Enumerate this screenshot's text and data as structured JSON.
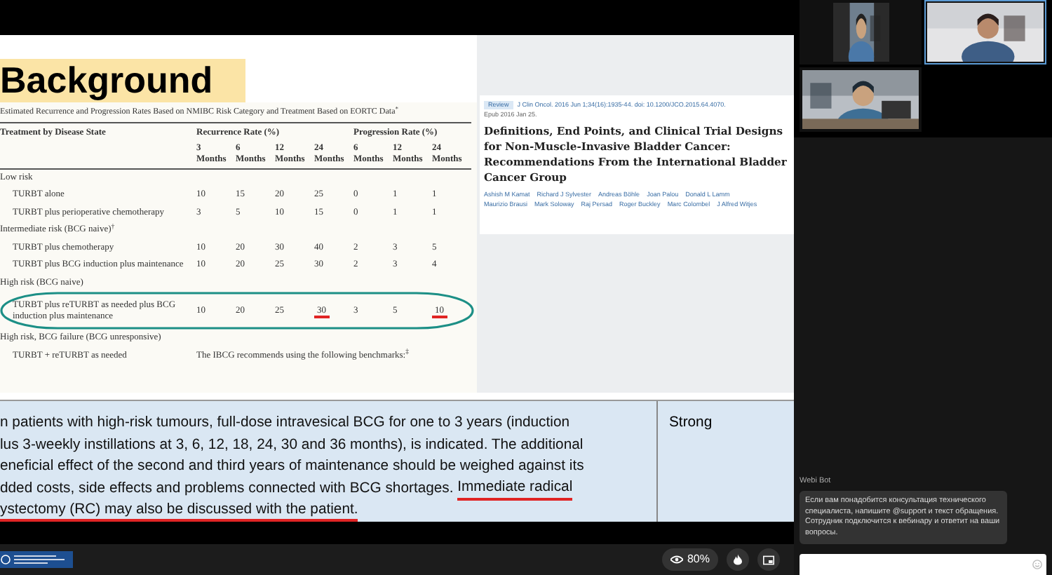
{
  "slide": {
    "title": "Background",
    "table": {
      "caption": "Estimated Recurrence and Progression Rates Based on NMIBC Risk Category and Treatment Based on EORTC Data$^{*}$",
      "columns": [
        "Treatment by Disease State",
        "Recurrence Rate (%)",
        "Progression Rate (%)"
      ],
      "subcolumns": [
        {
          "number": "3",
          "unit": "Months"
        },
        {
          "number": "6",
          "unit": "Months"
        },
        {
          "number": "12",
          "unit": "Months"
        },
        {
          "number": "24",
          "unit": "Months"
        },
        {
          "number": "6",
          "unit": "Months"
        },
        {
          "number": "12",
          "unit": "Months"
        },
        {
          "number": "24",
          "unit": "Months"
        }
      ],
      "rows": [
        {
          "kind": "group",
          "label": "Low risk"
        },
        {
          "kind": "item",
          "label": "TURBT alone",
          "circled": false,
          "values": [
            {
              "text": "10",
              "underlined": false
            },
            {
              "text": "15",
              "underlined": false
            },
            {
              "text": "20",
              "underlined": false
            },
            {
              "text": "25",
              "underlined": false
            },
            {
              "text": "0",
              "underlined": false
            },
            {
              "text": "1",
              "underlined": false
            },
            {
              "text": "1",
              "underlined": false
            }
          ]
        },
        {
          "kind": "item",
          "label": "TURBT plus perioperative chemotherapy",
          "circled": false,
          "values": [
            {
              "text": "3",
              "underlined": false
            },
            {
              "text": "5",
              "underlined": false
            },
            {
              "text": "10",
              "underlined": false
            },
            {
              "text": "15",
              "underlined": false
            },
            {
              "text": "0",
              "underlined": false
            },
            {
              "text": "1",
              "underlined": false
            },
            {
              "text": "1",
              "underlined": false
            }
          ]
        },
        {
          "kind": "group",
          "label": "Intermediate risk (BCG naive)$^{†}$"
        },
        {
          "kind": "item",
          "label": "TURBT plus chemotherapy",
          "circled": false,
          "values": [
            {
              "text": "10",
              "underlined": false
            },
            {
              "text": "20",
              "underlined": false
            },
            {
              "text": "30",
              "underlined": false
            },
            {
              "text": "40",
              "underlined": false
            },
            {
              "text": "2",
              "underlined": false
            },
            {
              "text": "3",
              "underlined": false
            },
            {
              "text": "5",
              "underlined": false
            }
          ]
        },
        {
          "kind": "item",
          "label": "TURBT plus BCG induction plus maintenance",
          "circled": false,
          "values": [
            {
              "text": "10",
              "underlined": false
            },
            {
              "text": "20",
              "underlined": false
            },
            {
              "text": "25",
              "underlined": false
            },
            {
              "text": "30",
              "underlined": false
            },
            {
              "text": "2",
              "underlined": false
            },
            {
              "text": "3",
              "underlined": false
            },
            {
              "text": "4",
              "underlined": false
            }
          ]
        },
        {
          "kind": "group",
          "label": "High risk (BCG naive)"
        },
        {
          "kind": "item",
          "label": "TURBT plus reTURBT as needed plus BCG induction plus maintenance",
          "circled": true,
          "values": [
            {
              "text": "10",
              "underlined": false
            },
            {
              "text": "20",
              "underlined": false
            },
            {
              "text": "25",
              "underlined": false
            },
            {
              "text": "30",
              "underlined": true
            },
            {
              "text": "3",
              "underlined": false
            },
            {
              "text": "5",
              "underlined": false
            },
            {
              "text": "10",
              "underlined": true
            }
          ]
        },
        {
          "kind": "group",
          "label": "High risk, BCG failure (BCG unresponsive)"
        },
        {
          "kind": "note",
          "label": "TURBT + reTURBT as needed",
          "note": "The IBCG recommends using the following benchmarks:$^{‡}$"
        }
      ]
    },
    "article": {
      "badge": "Review",
      "citation": "J Clin Oncol. 2016 Jun 1;34(16):1935-44. doi: 10.1200/JCO.2015.64.4070.",
      "epub": "Epub 2016 Jan 25.",
      "title": "Definitions, End Points, and Clinical Trial Designs for Non-Muscle-Invasive Bladder Cancer: Recommendations From the International Bladder Cancer Group",
      "authors": [
        "Ashish M Kamat",
        "Richard J Sylvester",
        "Andreas Böhle",
        "Joan Palou",
        "Donald L Lamm",
        "Maurizio Brausi",
        "Mark Soloway",
        "Raj Persad",
        "Roger Buckley",
        "Marc Colombel",
        "J Alfred Witjes"
      ]
    },
    "recommendation": {
      "lines": [
        [
          {
            "text": "n patients with high-risk tumours, full-dose intravesical BCG for one to 3 years (induction",
            "underlined": false
          }
        ],
        [
          {
            "text": "lus 3-weekly instillations at 3, 6, 12, 18, 24, 30 and 36 months), is indicated. The additional",
            "underlined": false
          }
        ],
        [
          {
            "text": "eneficial effect of the second and third years of maintenance should be weighed against its",
            "underlined": false
          }
        ],
        [
          {
            "text": "dded costs, side effects and problems connected with BCG shortages. ",
            "underlined": false
          },
          {
            "text": "Immediate radical",
            "underlined": true
          }
        ],
        [
          {
            "text": "ystectomy (RC) may also be discussed with the patient.",
            "underlined": true
          }
        ]
      ],
      "strength": "Strong"
    }
  },
  "controls": {
    "views": "80%"
  },
  "participants": [
    {
      "kind": "picture",
      "active": false
    },
    {
      "kind": "picture",
      "active": true
    },
    {
      "kind": "picture",
      "active": false
    }
  ],
  "chat": {
    "sender": "Webi Bot",
    "message": "Если вам понадобится консультация технического специалиста, напишите @support и текст обращения. Сотрудник подключится к вебинару и ответит на ваши вопросы."
  }
}
